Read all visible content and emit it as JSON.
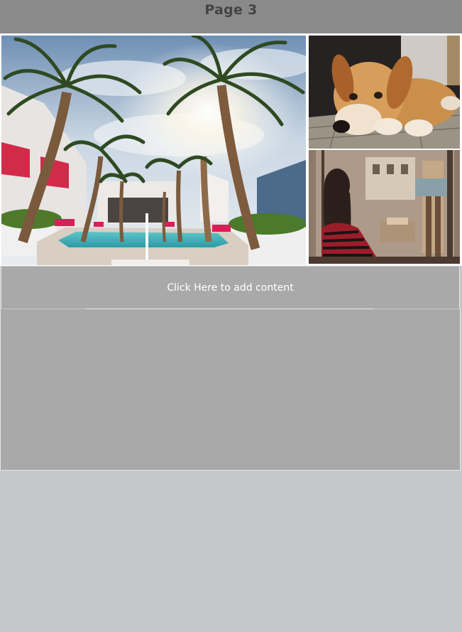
{
  "header": {
    "title": "Page 3"
  },
  "gallery": {
    "images": [
      {
        "name": "resort-pool-palms-photo"
      },
      {
        "name": "golden-retriever-photo"
      },
      {
        "name": "girl-at-shop-window-photo"
      }
    ]
  },
  "add_content": {
    "label": "Click Here to add content"
  },
  "colors": {
    "header_bg": "#8a8a8a",
    "title_text": "#444444",
    "panel_bg": "#a9a9a9",
    "page_bg": "#c5c8cb"
  }
}
